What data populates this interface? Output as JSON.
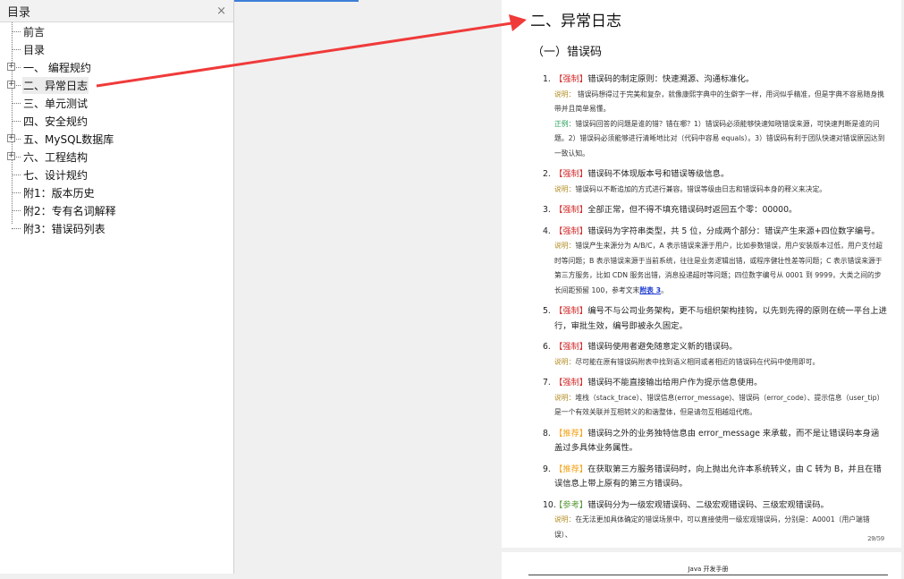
{
  "sidebar": {
    "title": "目录",
    "close": "×",
    "items": [
      {
        "label": "前言",
        "expandable": false
      },
      {
        "label": "目录",
        "expandable": false
      },
      {
        "label": "一、 编程规约",
        "expandable": true
      },
      {
        "label": "二、异常日志",
        "expandable": true,
        "selected": true
      },
      {
        "label": "三、单元测试",
        "expandable": false
      },
      {
        "label": "四、安全规约",
        "expandable": false
      },
      {
        "label": "五、MySQL数据库",
        "expandable": true
      },
      {
        "label": "六、工程结构",
        "expandable": true
      },
      {
        "label": "七、设计规约",
        "expandable": false
      },
      {
        "label": "附1：版本历史",
        "expandable": false
      },
      {
        "label": "附2：专有名词解释",
        "expandable": false
      },
      {
        "label": "附3：错误码列表",
        "expandable": false
      }
    ]
  },
  "doc": {
    "heading": "二、异常日志",
    "subheading": "（一）错误码",
    "page_number": "29/59",
    "next_page_header": "Java 开发手册",
    "items": [
      {
        "num": "1.",
        "tag": "【强制】",
        "tag_color": "r",
        "text": "错误码的制定原则：快速溯源、沟通标准化。",
        "notes": [
          {
            "k": "说明：",
            "t": " 错误码想得过于完美和复杂，就像康熙字典中的生僻字一样，用词似乎精准，但是字典不容易随身携带并且简单易懂。"
          },
          {
            "k": "正例：",
            "kg": true,
            "t": "错误码回答的问题是谁的错？错在哪？1）错误码必须能够快速知晓错误来源，可快速判断是谁的问题。2）错误码必须能够进行清晰地比对（代码中容易 equals）。3）错误码有利于团队快速对错误原因达到一致认知。"
          }
        ]
      },
      {
        "num": "2.",
        "tag": "【强制】",
        "tag_color": "r",
        "text": "错误码不体现版本号和错误等级信息。",
        "notes": [
          {
            "k": "说明：",
            "t": "错误码以不断追加的方式进行兼容。错误等级由日志和错误码本身的释义来决定。"
          }
        ]
      },
      {
        "num": "3.",
        "tag": "【强制】",
        "tag_color": "r",
        "text": "全部正常，但不得不填充错误码时返回五个零：00000。",
        "notes": []
      },
      {
        "num": "4.",
        "tag": "【强制】",
        "tag_color": "r",
        "text": "错误码为字符串类型，共 5 位，分成两个部分：错误产生来源+四位数字编号。",
        "notes": [
          {
            "k": "说明：",
            "t": "错误产生来源分为 A/B/C，A 表示错误来源于用户，比如参数错误，用户安装版本过低，用户支付超时等问题；B 表示错误来源于当前系统，往往是业务逻辑出错，或程序健壮性差等问题；C 表示错误来源于第三方服务，比如 CDN 服务出错，消息投递超时等问题；四位数字编号从 0001 到 9999，大类之间的步长间距预留 100，参考文末",
            "link": "附表 3",
            "after": "。"
          }
        ]
      },
      {
        "num": "5.",
        "tag": "【强制】",
        "tag_color": "r",
        "text": "编号不与公司业务架构，更不与组织架构挂钩，以先到先得的原则在统一平台上进行，审批生效，编号即被永久固定。",
        "notes": []
      },
      {
        "num": "6.",
        "tag": "【强制】",
        "tag_color": "r",
        "text": "错误码使用者避免随意定义新的错误码。",
        "notes": [
          {
            "k": "说明：",
            "t": "尽可能在原有错误码附表中找到语义相同或者相近的错误码在代码中使用即可。"
          }
        ]
      },
      {
        "num": "7.",
        "tag": "【强制】",
        "tag_color": "r",
        "text": "错误码不能直接输出给用户作为提示信息使用。",
        "notes": [
          {
            "k": "说明：",
            "t": "堆栈（stack_trace）、错误信息(error_message)、错误码（error_code）、提示信息（user_tip）是一个有效关联并互相转义的和谐整体，但是请勿互相越俎代庖。"
          }
        ]
      },
      {
        "num": "8.",
        "tag": "【推荐】",
        "tag_color": "o",
        "text": "错误码之外的业务独特信息由 error_message 来承载，而不是让错误码本身涵盖过多具体业务属性。",
        "notes": []
      },
      {
        "num": "9.",
        "tag": "【推荐】",
        "tag_color": "o",
        "text": "在获取第三方服务错误码时，向上抛出允许本系统转义，由 C 转为 B，并且在错误信息上带上原有的第三方错误码。",
        "notes": []
      },
      {
        "num": "10.",
        "tag": "【参考】",
        "tag_color": "g",
        "text": "错误码分为一级宏观错误码、二级宏观错误码、三级宏观错误码。",
        "notes": [
          {
            "k": "说明：",
            "t": "在无法更加具体确定的错误场景中，可以直接使用一级宏观错误码，分别是：A0001（用户端错误）、"
          }
        ]
      }
    ]
  },
  "colors": {
    "accent": "#3c7fd8",
    "arrow": "#f03a3a",
    "mandatory": "#d12b2b",
    "recommended": "#f3a21a",
    "reference": "#5a9a3a"
  }
}
